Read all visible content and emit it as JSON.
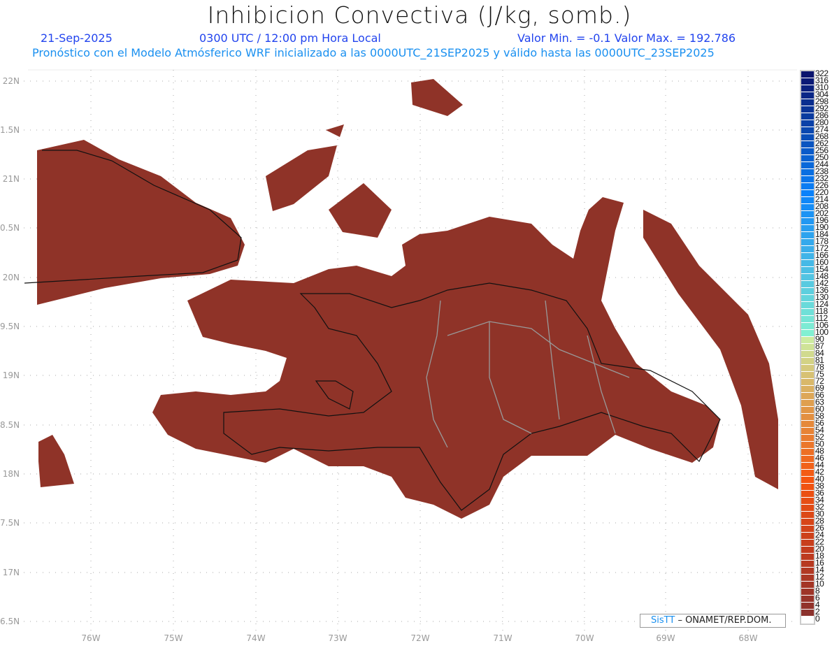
{
  "header": {
    "title": "Inhibicion Convectiva (J/kg, somb.)",
    "date": "21-Sep-2025",
    "time": "0300 UTC / 12:00 pm Hora Local",
    "minmax": "Valor Min. = -0.1  Valor Max. = 192.786",
    "forecast": "Pronóstico con el Modelo Atmósferico WRF inicializado a las 0000UTC_21SEP2025 y válido hasta las  0000UTC_23SEP2025"
  },
  "axes": {
    "y_labels": [
      "22N",
      "1.5N",
      "21N",
      "0.5N",
      "20N",
      "9.5N",
      "19N",
      "8.5N",
      "18N",
      "7.5N",
      "17N",
      "6.5N"
    ],
    "x_labels": [
      "76W",
      "75W",
      "74W",
      "73W",
      "72W",
      "71W",
      "70W",
      "69W",
      "68W"
    ]
  },
  "colorbar": {
    "labels": [
      "322",
      "316",
      "310",
      "304",
      "298",
      "292",
      "286",
      "280",
      "274",
      "268",
      "262",
      "256",
      "250",
      "244",
      "238",
      "232",
      "226",
      "220",
      "214",
      "208",
      "202",
      "196",
      "190",
      "184",
      "178",
      "172",
      "166",
      "160",
      "154",
      "148",
      "142",
      "136",
      "130",
      "124",
      "118",
      "112",
      "106",
      "100",
      "90",
      "87",
      "84",
      "81",
      "78",
      "75",
      "72",
      "69",
      "66",
      "63",
      "60",
      "58",
      "56",
      "54",
      "52",
      "50",
      "48",
      "46",
      "44",
      "42",
      "40",
      "38",
      "36",
      "34",
      "32",
      "30",
      "28",
      "26",
      "24",
      "22",
      "20",
      "18",
      "16",
      "14",
      "12",
      "10",
      "8",
      "6",
      "4",
      "2",
      "0"
    ]
  },
  "credit": {
    "brand": "SisTT",
    "org": "– ONAMET/REP.DOM."
  },
  "colors": {
    "base": "#8f3328",
    "orange": "#f0601a",
    "cyan": "#7ee8d8",
    "title_blue": "#2244ee",
    "sub_blue": "#1a90f0"
  }
}
